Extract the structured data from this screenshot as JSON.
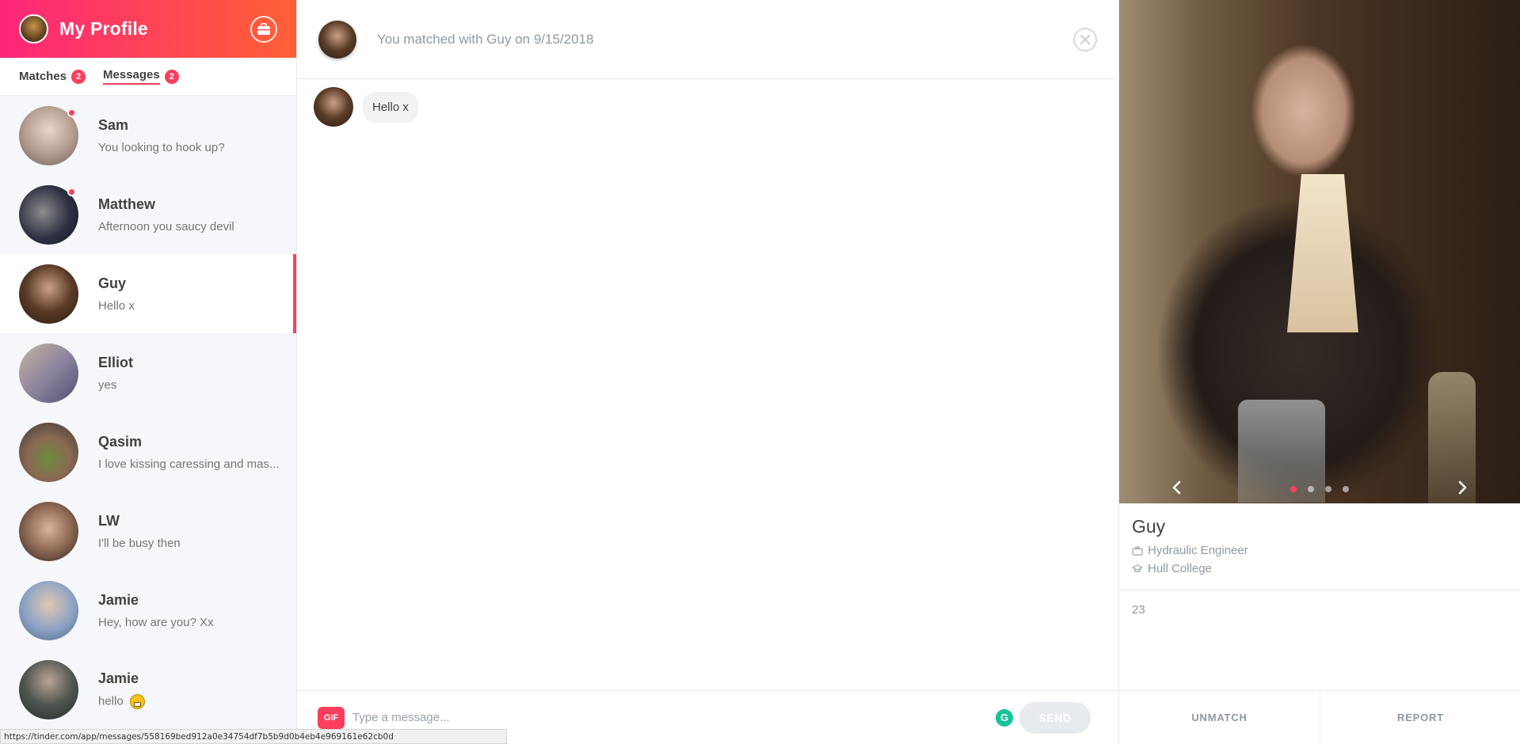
{
  "header": {
    "title": "My Profile"
  },
  "tabs": [
    {
      "label": "Matches",
      "count": "2"
    },
    {
      "label": "Messages",
      "count": "2"
    }
  ],
  "conversations": [
    {
      "name": "Sam",
      "preview": "You looking to hook up?",
      "unread": true
    },
    {
      "name": "Matthew",
      "preview": "Afternoon you saucy devil",
      "unread": true
    },
    {
      "name": "Guy",
      "preview": "Hello x",
      "selected": true
    },
    {
      "name": "Elliot",
      "preview": "yes"
    },
    {
      "name": "Qasim",
      "preview": "I love kissing caressing and mas..."
    },
    {
      "name": "LW",
      "preview": "I'll be busy then"
    },
    {
      "name": "Jamie",
      "preview": "Hey, how are you? Xx"
    },
    {
      "name": "Jamie",
      "preview": "hello",
      "emoji": "grinning-face-icon"
    }
  ],
  "chat": {
    "matched_text": "You matched with Guy on 9/15/2018",
    "messages": [
      {
        "text": "Hello x"
      }
    ],
    "composer": {
      "gif_label": "GIF",
      "placeholder": "Type a message...",
      "send_label": "SEND",
      "grammarly_label": "G"
    }
  },
  "status_bar": {
    "url": "https://tinder.com/app/messages/558169bed912a0e34754df7b5b9d0b4eb4e969161e62cb0d"
  },
  "profile": {
    "name": "Guy",
    "job": "Hydraulic Engineer",
    "school": "Hull College",
    "age": "23",
    "photo_count": 4,
    "active_photo": 1,
    "actions": {
      "unmatch": "UNMATCH",
      "report": "REPORT"
    }
  },
  "colors": {
    "brand_start": "#fd267a",
    "brand_end": "#ff6036",
    "accent": "#fd3e5c"
  }
}
